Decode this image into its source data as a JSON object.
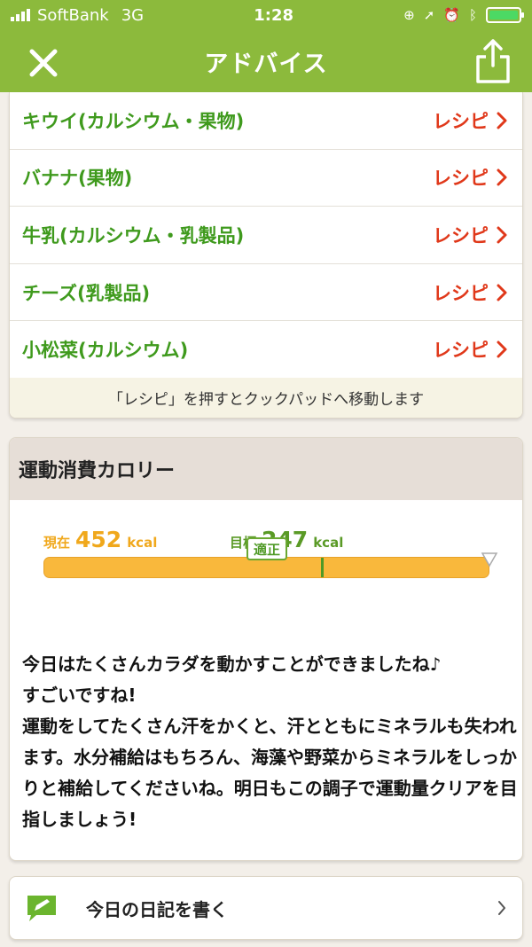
{
  "status_bar": {
    "carrier": "SoftBank",
    "network": "3G",
    "time": "1:28"
  },
  "nav": {
    "title": "アドバイス"
  },
  "foods": [
    {
      "name": "キウイ(カルシウム・果物)",
      "link_label": "レシピ"
    },
    {
      "name": "バナナ(果物)",
      "link_label": "レシピ"
    },
    {
      "name": "牛乳(カルシウム・乳製品)",
      "link_label": "レシピ"
    },
    {
      "name": "チーズ(乳製品)",
      "link_label": "レシピ"
    },
    {
      "name": "小松菜(カルシウム)",
      "link_label": "レシピ"
    }
  ],
  "food_note": "「レシピ」を押すとクックパッドへ移動します",
  "exercise": {
    "header": "運動消費カロリー",
    "current_label": "現在",
    "current_value": "452",
    "current_unit": "kcal",
    "target_label": "目標",
    "target_value": "247",
    "target_unit": "kcal",
    "status": "適正",
    "message": "今日はたくさんカラダを動かすことができましたね♪\nすごいですね!\n運動をしてたくさん汗をかくと、汗とともにミネラルも失われます。水分補給はもちろん、海藻や野菜からミネラルをしっかりと補給してくださいね。明日もこの調子で運動量クリアを目指しましょう!"
  },
  "diary": {
    "label": "今日の日記を書く"
  },
  "colors": {
    "header_green": "#8cba3c",
    "food_green": "#3f9a1d",
    "recipe_red": "#e0381a",
    "bar_orange": "#f9b83c"
  },
  "icons": [
    "close-icon",
    "share-icon",
    "chevron-right-icon",
    "pencil-icon"
  ]
}
